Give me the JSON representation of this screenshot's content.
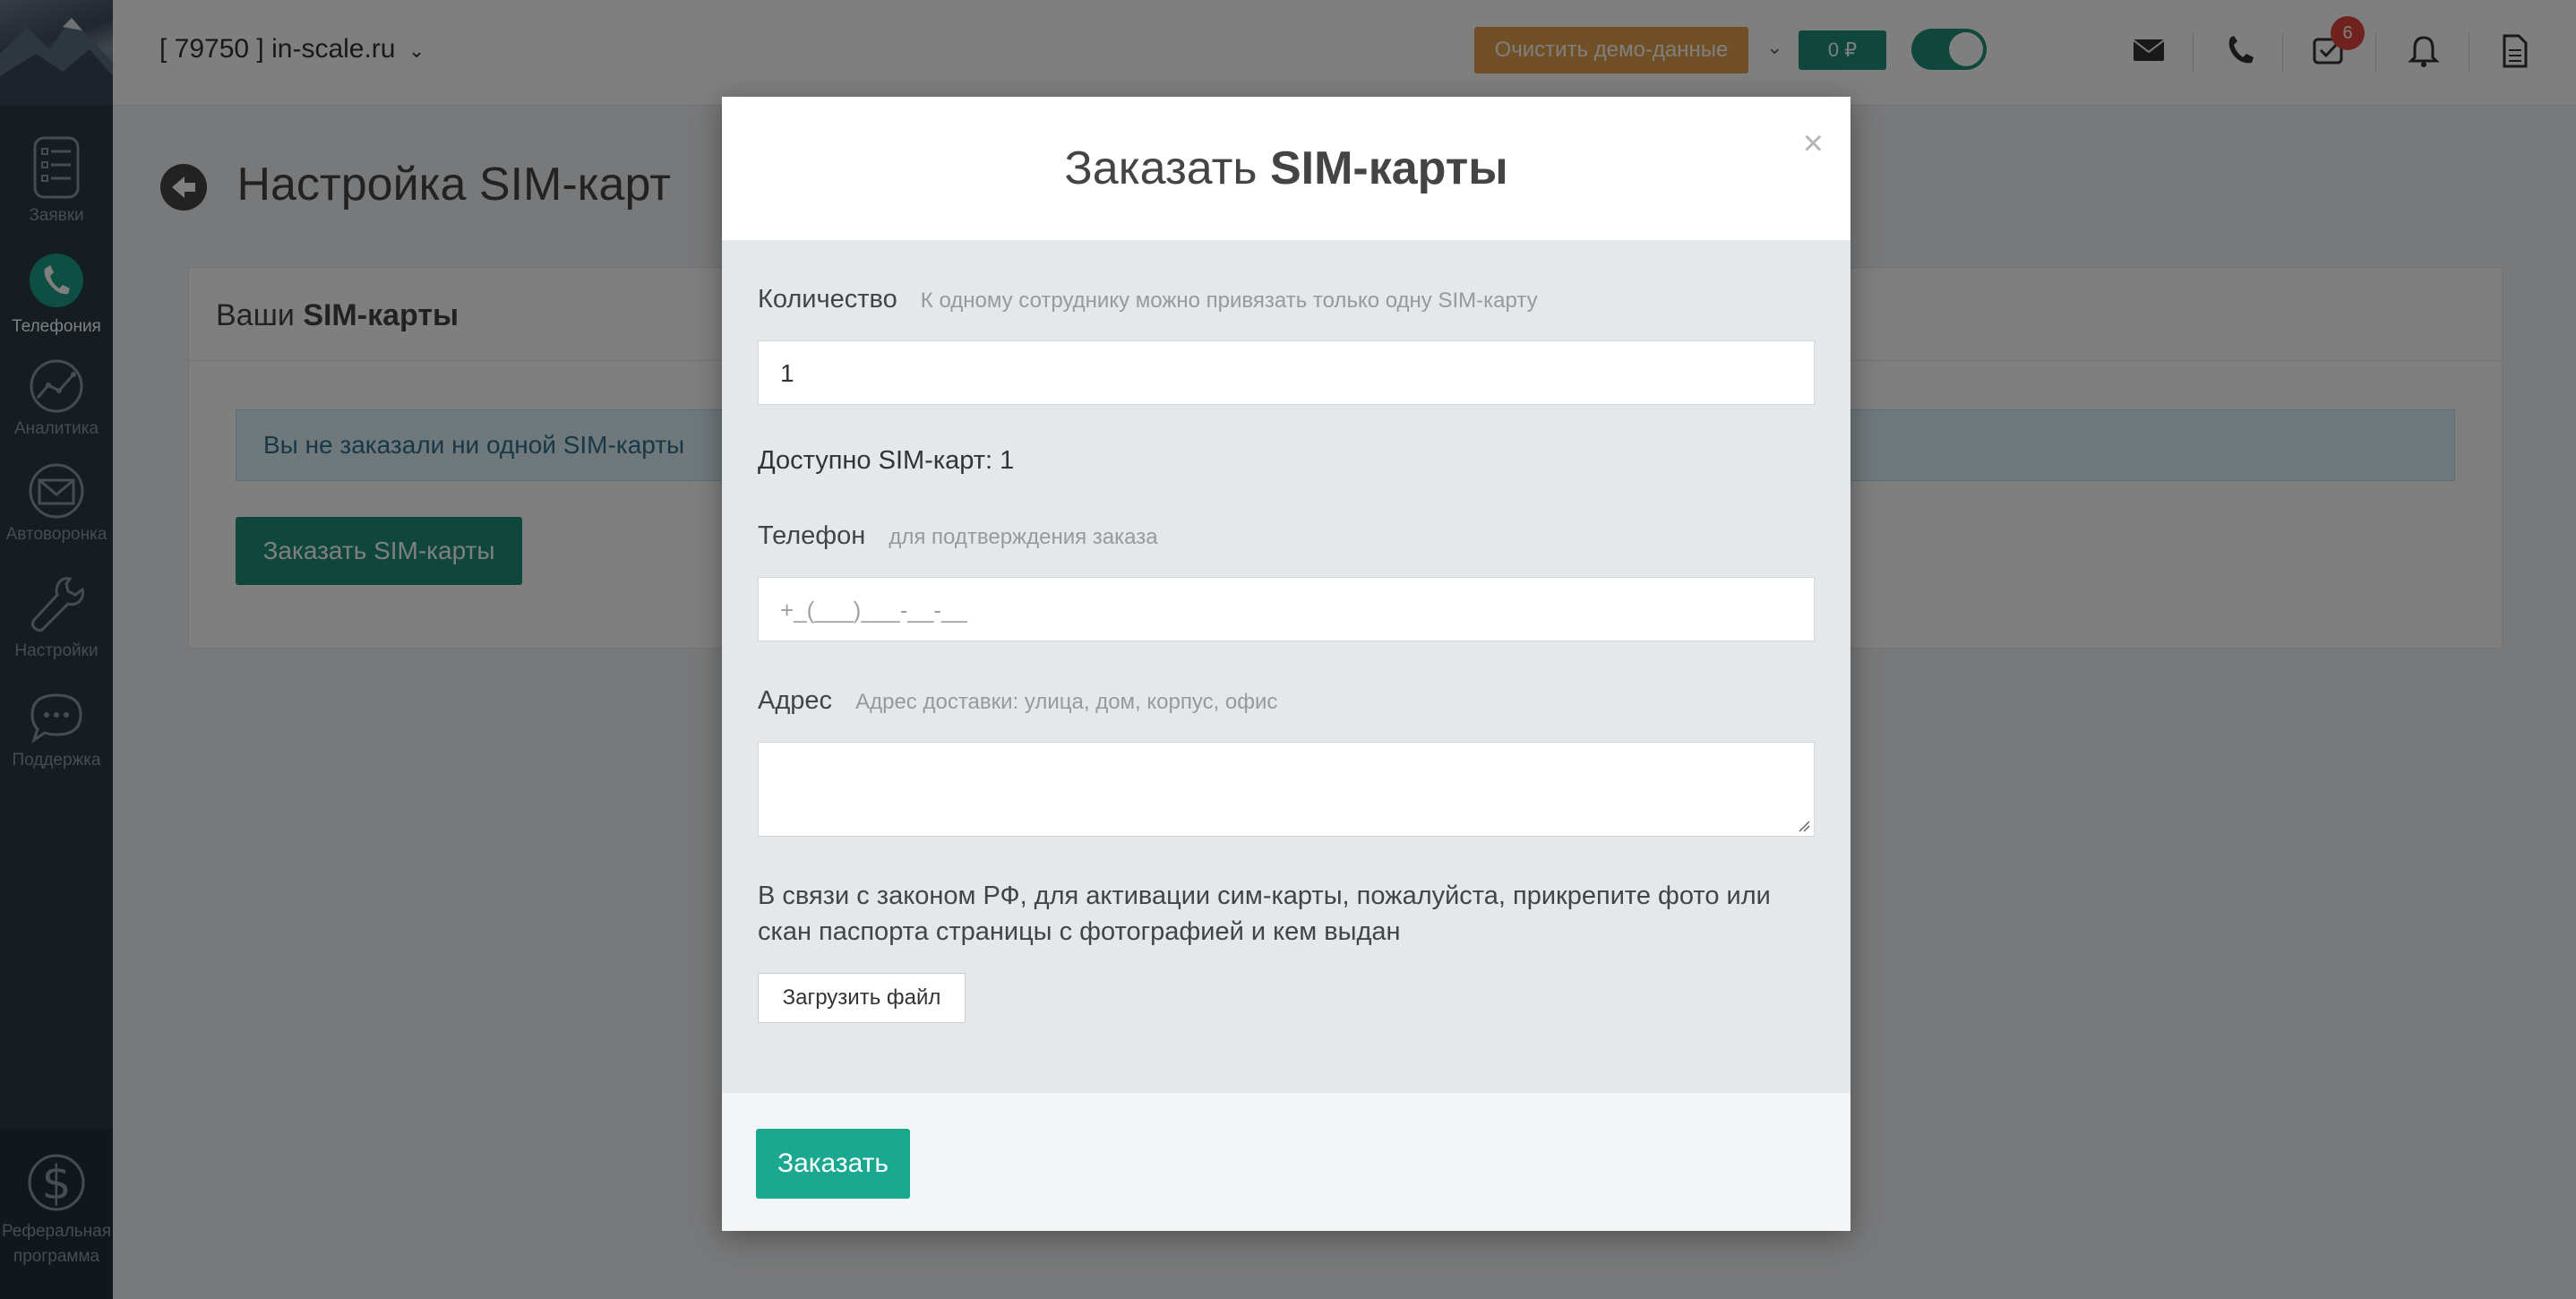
{
  "topbar": {
    "account": "[ 79750 ] in-scale.ru",
    "demo_button": "Очистить демо-данные",
    "balance": "0 ₽",
    "tasks_badge": "6"
  },
  "sidebar": {
    "items": [
      {
        "label": "Заявки",
        "icon": "list-icon"
      },
      {
        "label": "Телефония",
        "icon": "phone-icon",
        "active": true
      },
      {
        "label": "Аналитика",
        "icon": "analytics-icon"
      },
      {
        "label": "Автоворонка",
        "icon": "mail-icon"
      },
      {
        "label": "Настройки",
        "icon": "wrench-icon"
      },
      {
        "label": "Поддержка",
        "icon": "chat-icon"
      }
    ],
    "referral_line1": "Реферальная",
    "referral_line2": "программа"
  },
  "page": {
    "title": "Настройка SIM-карт",
    "card_title_prefix": "Ваши",
    "card_title_bold": "SIM-карты",
    "info": "Вы не заказали ни одной SIM-карты",
    "order_button": "Заказать SIM-карты"
  },
  "modal": {
    "title_prefix": "Заказать",
    "title_bold": "SIM-карты",
    "close": "×",
    "quantity_label": "Количество",
    "quantity_hint": "К одному сотруднику можно привязать только одну SIM-карту",
    "quantity_value": "1",
    "available": "Доступно SIM-карт: 1",
    "phone_label": "Телефон",
    "phone_hint": "для подтверждения заказа",
    "phone_placeholder": "+_(___)___-__-__",
    "address_label": "Адрес",
    "address_hint": "Адрес доставки: улица, дом, корпус, офис",
    "address_value": "",
    "law_text": "В связи с законом РФ, для активации сим-карты, пожалуйста, прикрепите фото или скан паспорта страницы с фотографией и кем выдан",
    "upload_button": "Загрузить файл",
    "submit_button": "Заказать"
  },
  "colors": {
    "accent": "#1aa890",
    "sidebar": "#2b3a45",
    "demo_button": "#e2a04a",
    "badge": "#e0463c"
  }
}
